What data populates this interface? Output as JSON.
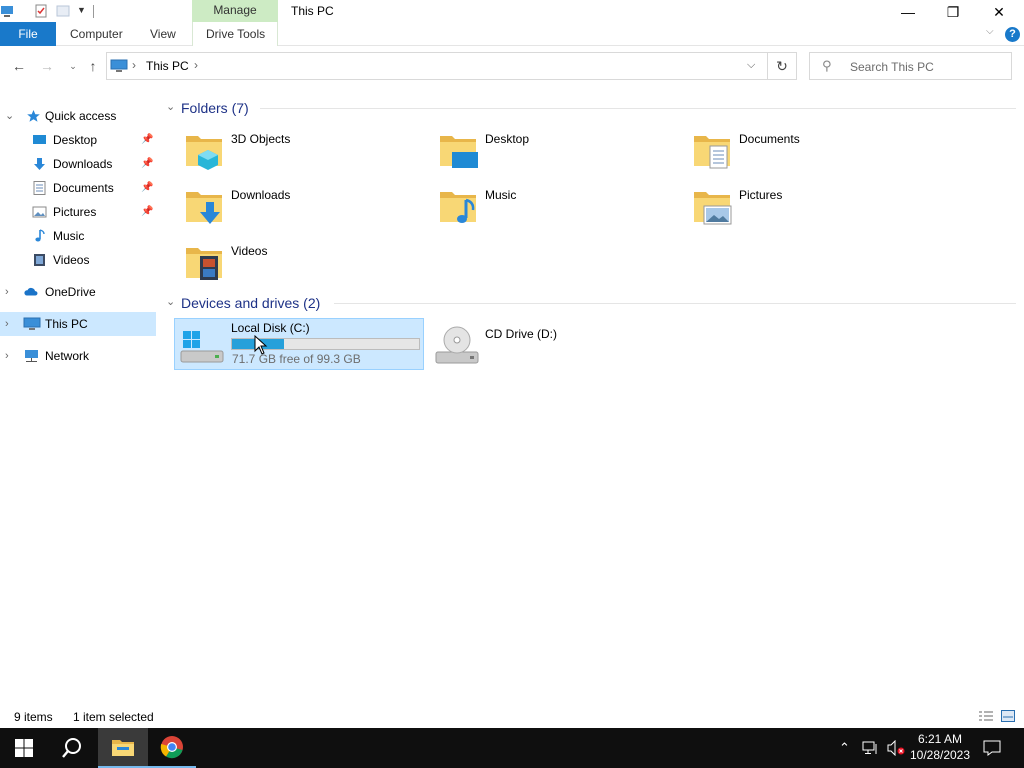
{
  "window": {
    "title": "This PC",
    "context_tab": "Manage",
    "minimize": "—",
    "restore": "❐",
    "close": "✕"
  },
  "ribbon": {
    "file": "File",
    "tabs": [
      "Computer",
      "View",
      "Drive Tools"
    ],
    "help": "?"
  },
  "address": {
    "path": "This PC",
    "search_placeholder": "Search This PC"
  },
  "nav": {
    "quick_access": "Quick access",
    "quick_items": [
      "Desktop",
      "Downloads",
      "Documents",
      "Pictures",
      "Music",
      "Videos"
    ],
    "onedrive": "OneDrive",
    "this_pc": "This PC",
    "network": "Network"
  },
  "content": {
    "folders_header": "Folders (7)",
    "folders": [
      "3D Objects",
      "Desktop",
      "Documents",
      "Downloads",
      "Music",
      "Pictures",
      "Videos"
    ],
    "devices_header": "Devices and drives (2)",
    "drive_c": {
      "name": "Local Disk (C:)",
      "free_text": "71.7 GB free of 99.3 GB",
      "used_fraction": 0.278
    },
    "drive_d": {
      "name": "CD Drive (D:)"
    }
  },
  "status": {
    "items": "9 items",
    "selected": "1 item selected"
  },
  "taskbar": {
    "time": "6:21 AM",
    "date": "10/28/2023"
  },
  "colors": {
    "file_tab": "#1979ca",
    "selection": "#cce8ff",
    "drive_fill": "#26a0da",
    "manage_tab": "#cdebc4",
    "taskbar": "#0f0f0f"
  }
}
